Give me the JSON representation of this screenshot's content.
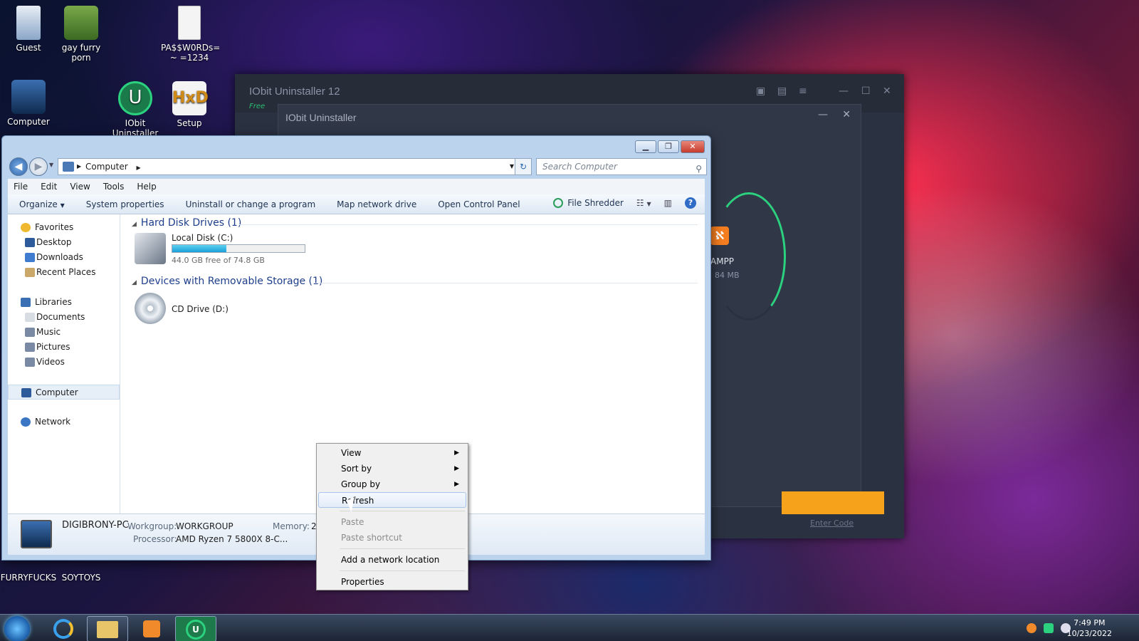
{
  "desktop": {
    "icons": [
      {
        "label": "Guest"
      },
      {
        "label": "gay furry\nporn"
      },
      {
        "label": "PA$$W0RDs=\n~ =1234"
      },
      {
        "label": "Computer"
      },
      {
        "label": "IObit\nUninstaller"
      },
      {
        "label": "Setup"
      },
      {
        "label": "FURRYFUCKS"
      },
      {
        "label": "SOYTOYS"
      }
    ]
  },
  "iobit": {
    "title": "IObit Uninstaller 12",
    "sub": "Free",
    "inner_title": "IObit Uninstaller",
    "item_name": "AMPP",
    "item_size": "84 MB",
    "enter_code": "Enter Code"
  },
  "explorer": {
    "breadcrumb": "Computer",
    "search_placeholder": "Search Computer",
    "menu": [
      "File",
      "Edit",
      "View",
      "Tools",
      "Help"
    ],
    "commands": {
      "organize": "Organize",
      "system_properties": "System properties",
      "uninstall": "Uninstall or change a program",
      "map_drive": "Map network drive",
      "control_panel": "Open Control Panel",
      "file_shredder": "File Shredder"
    },
    "nav": {
      "favorites": "Favorites",
      "desktop": "Desktop",
      "downloads": "Downloads",
      "recent": "Recent Places",
      "libraries": "Libraries",
      "documents": "Documents",
      "music": "Music",
      "pictures": "Pictures",
      "videos": "Videos",
      "computer": "Computer",
      "network": "Network"
    },
    "groups": {
      "hdd": "Hard Disk Drives (1)",
      "removable": "Devices with Removable Storage (1)"
    },
    "drives": {
      "c_name": "Local Disk (C:)",
      "c_free": "44.0 GB free of 74.8 GB",
      "c_used_fraction": 0.41,
      "d_name": "CD Drive (D:)"
    },
    "details": {
      "pc_name": "DIGIBRONY-PC",
      "workgroup_label": "Workgroup:",
      "workgroup_value": "WORKGROUP",
      "memory_label": "Memory:",
      "memory_value": "2.",
      "processor_label": "Processor:",
      "processor_value": "AMD Ryzen 7 5800X 8-C..."
    }
  },
  "context_menu": {
    "view": "View",
    "sort_by": "Sort by",
    "group_by": "Group by",
    "refresh": "Refresh",
    "paste": "Paste",
    "paste_shortcut": "Paste shortcut",
    "add_network": "Add a network location",
    "properties": "Properties"
  },
  "taskbar": {
    "time": "7:49 PM",
    "date": "10/23/2022"
  }
}
